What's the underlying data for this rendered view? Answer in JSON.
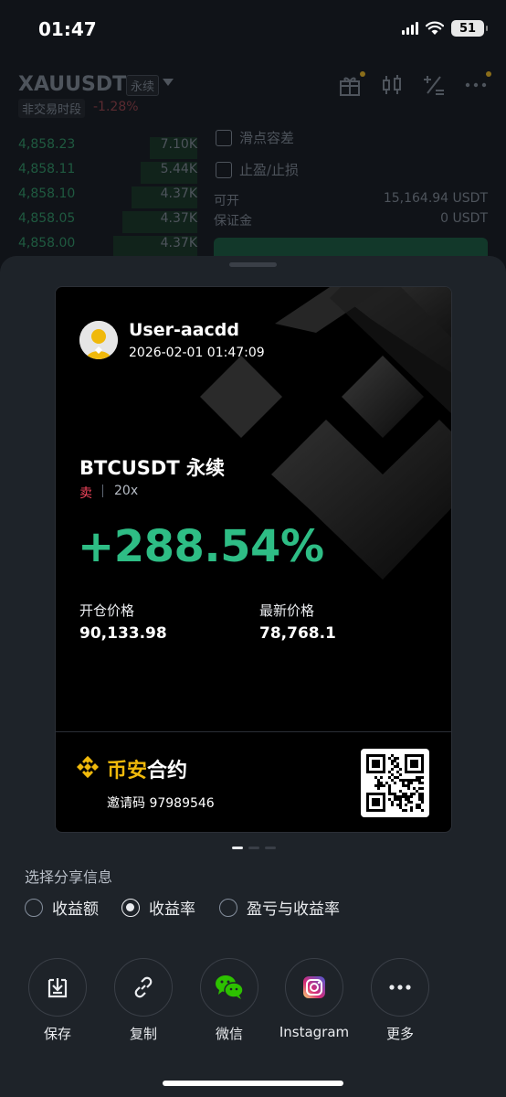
{
  "status_bar": {
    "time": "01:47",
    "battery": "51"
  },
  "header": {
    "symbol": "XAUUSDT",
    "perp_tag": "永续",
    "session_tag": "非交易时段",
    "change": "-1.28%"
  },
  "orderbook": [
    {
      "price": "4,858.23",
      "qty": "7.10K"
    },
    {
      "price": "4,858.11",
      "qty": "5.44K"
    },
    {
      "price": "4,858.10",
      "qty": "4.37K"
    },
    {
      "price": "4,858.05",
      "qty": "4.37K"
    },
    {
      "price": "4,858.00",
      "qty": "4.37K"
    }
  ],
  "order_panel": {
    "slippage_label": "滑点容差",
    "tpsl_label": "止盈/止损",
    "available_label": "可开",
    "available_value": "15,164.94 USDT",
    "margin_label": "保证金",
    "margin_value": "0 USDT"
  },
  "card": {
    "username": "User-aacdd",
    "timestamp": "2026-02-01 01:47:09",
    "pair": "BTCUSDT 永续",
    "side": "卖",
    "leverage": "20x",
    "pnl_percent": "+288.54%",
    "open_price_label": "开仓价格",
    "open_price": "90,133.98",
    "last_price_label": "最新价格",
    "last_price": "78,768.1",
    "brand_a": "币安",
    "brand_b": "合约",
    "invite": "邀请码 97989546",
    "colors": {
      "profit": "#2ebd85",
      "sell": "#f6465d",
      "brand": "#f0b90b"
    }
  },
  "share_options": {
    "title": "选择分享信息",
    "options": [
      {
        "label": "收益额",
        "selected": false
      },
      {
        "label": "收益率",
        "selected": true
      },
      {
        "label": "盈亏与收益率",
        "selected": false
      }
    ]
  },
  "actions": [
    {
      "label": "保存",
      "icon": "save-icon"
    },
    {
      "label": "复制",
      "icon": "link-icon"
    },
    {
      "label": "微信",
      "icon": "wechat-icon"
    },
    {
      "label": "Instagram",
      "icon": "instagram-icon"
    },
    {
      "label": "更多",
      "icon": "more-icon"
    }
  ]
}
